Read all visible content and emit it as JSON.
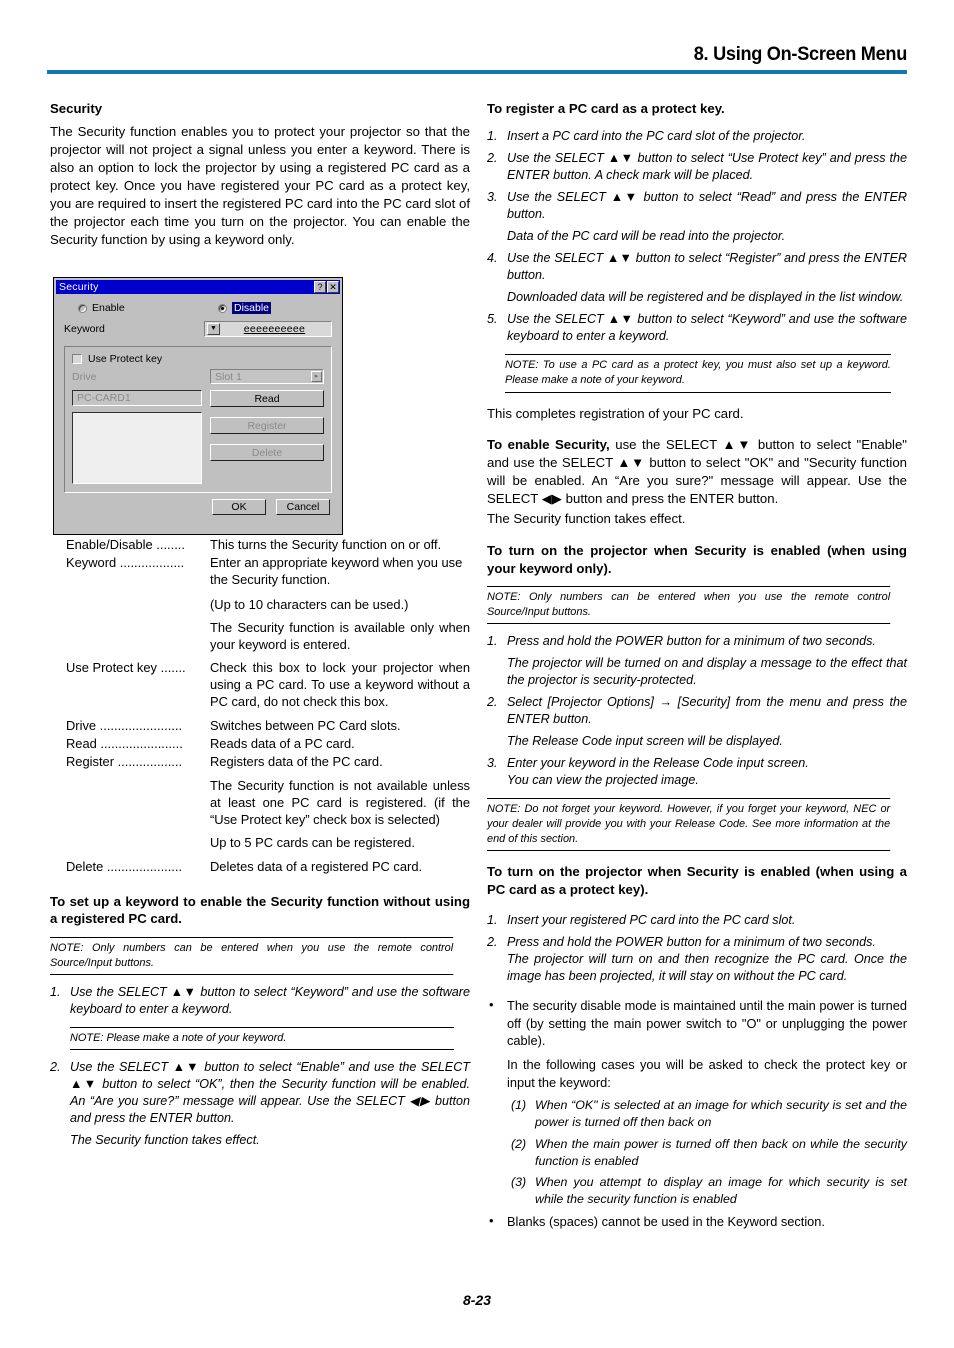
{
  "header": {
    "title": "8. Using On-Screen Menu",
    "rule_color": "#1478ae"
  },
  "left_column": {
    "section_title": "Security",
    "intro": "The Security function enables you to protect your projector so that the projector will not project a signal unless you enter a keyword. There is also an option to lock the projector by using a registered PC card as a protect key. Once you have registered your PC card as a protect key, you are required to insert the registered PC card into the PC card slot of the projector each time you turn on the projector. You can enable the Security function by using a keyword only.",
    "definitions": [
      {
        "term": "Enable/Disable ........",
        "desc": "This turns the Security function on or off.",
        "extra": []
      },
      {
        "term": "Keyword ..................",
        "desc": "Enter an appropriate keyword when you use the Security function.",
        "extra": [
          "(Up to 10 characters can be used.)",
          "The Security function is available only when your keyword is entered."
        ]
      },
      {
        "term": "Use Protect key .......",
        "desc": "Check this box to lock your projector when using a PC card. To use a keyword without a PC card, do not check this box.",
        "extra": []
      },
      {
        "term": "Drive .......................",
        "desc": "Switches between PC Card slots.",
        "extra": []
      },
      {
        "term": "Read .......................",
        "desc": "Reads data of a PC card.",
        "extra": []
      },
      {
        "term": "Register ..................",
        "desc": "Registers data of the PC card.",
        "extra": [
          "The Security function is not available unless at least one PC card is registered. (if the “Use Protect key” check box is selected)",
          "Up to 5 PC cards can be registered."
        ]
      },
      {
        "term": "Delete .....................",
        "desc": "Deletes data of a registered PC card.",
        "extra": []
      }
    ],
    "setup_heading": "To set up a keyword to enable the Security function without using a registered PC card.",
    "setup_note": "NOTE: Only numbers can be entered when you use the remote control Source/Input buttons.",
    "setup_steps": [
      {
        "num": "1.",
        "text": "Use the SELECT ▲▼ button to select “Keyword” and use the software keyboard to enter a keyword.",
        "note": "NOTE: Please make a note of your keyword."
      },
      {
        "num": "2.",
        "text": "Use the SELECT ▲▼ button to select “Enable” and use the SELECT ▲▼ button to select “OK”, then the Security function will be enabled. An “Are you sure?” message will appear. Use the SELECT ◀▶ button and press the ENTER button.",
        "note": "",
        "tail": "The Security function takes effect."
      }
    ]
  },
  "dialog": {
    "title": "Security",
    "help_button": "?",
    "close_button": "✕",
    "enable_label": "Enable",
    "disable_label": "Disable",
    "keyword_label": "Keyword",
    "keyword_value": "eeeeeeeeee",
    "dropdown_arrow": "▼",
    "use_protect_key_label": "Use Protect key",
    "drive_label": "Drive",
    "slot_value": "Slot 1",
    "slot_arrow": "▸",
    "pc_card_value": "PC-CARD1",
    "read_button": "Read",
    "register_button": "Register",
    "delete_button": "Delete",
    "ok_button": "OK",
    "cancel_button": "Cancel",
    "title_bar_color": "#0000cd",
    "face_color": "#c0c0c0",
    "selection_color": "#000080"
  },
  "right_column": {
    "register_heading": "To register a PC card as a protect key.",
    "register_steps": [
      {
        "num": "1.",
        "text": "Insert a PC card into the PC card slot of the projector."
      },
      {
        "num": "2.",
        "text": "Use the SELECT ▲▼ button to select “Use Protect key” and press the ENTER button. A check mark will be placed."
      },
      {
        "num": "3.",
        "text": "Use the SELECT ▲▼ button to select “Read” and press the ENTER button."
      },
      {
        "num": "",
        "text": "Data of the PC card will be read into the projector.",
        "plain": true
      },
      {
        "num": "4.",
        "text": "Use the SELECT ▲▼ button to select “Register” and press the ENTER button."
      },
      {
        "num": "",
        "text": "Downloaded data will be registered and be displayed in the list window.",
        "plain": true
      },
      {
        "num": "5.",
        "text": "Use the SELECT ▲▼ button to select “Keyword” and use the software keyboard to enter a keyword."
      }
    ],
    "register_note": "NOTE: To use a PC card as a protect key, you must also set up a keyword. Please make a note of your keyword.",
    "completes_text": "This completes registration of your PC card.",
    "enable_security_lead": "To enable Security,",
    "enable_security_body": " use the SELECT ▲▼ button to select \"Enable\" and use the SELECT ▲▼ button to select \"OK\" and \"Security function will be enabled. An “Are you sure?\" message will appear. Use the SELECT ◀▶ button and press the ENTER button.",
    "enable_security_tail": "The Security function takes effect.",
    "keyword_only_heading": "To turn on the projector when Security is enabled (when using your keyword only).",
    "keyword_only_note": "NOTE: Only numbers can be entered when you use the remote control Source/Input buttons.",
    "keyword_only_steps": [
      {
        "num": "1.",
        "text": "Press and hold the POWER button for a minimum of two seconds."
      },
      {
        "num": "",
        "text": "The projector will be turned on and display a message to the effect that the projector is security-protected.",
        "plain": true
      },
      {
        "num": "2.",
        "text": "Select [Projector Options] → [Security] from the menu and press the ENTER button."
      },
      {
        "num": "",
        "text": "The Release Code input screen will be displayed.",
        "plain": true
      },
      {
        "num": "3.",
        "text": "Enter your keyword in the Release Code input screen.",
        "tail": "You can view the projected image."
      }
    ],
    "keyword_only_note2": "NOTE: Do not forget your keyword. However, if you forget your keyword, NEC or your dealer will provide you with your Release Code. See more information at the end of this section.",
    "pc_card_heading": "To turn on the projector when Security is enabled (when using a PC card as a protect key).",
    "pc_card_steps": [
      {
        "num": "1.",
        "text": "Insert your registered PC card into the PC card slot."
      },
      {
        "num": "2.",
        "text": "Press and hold the POWER button for a minimum of two seconds.",
        "tail": "The projector will turn on and then recognize the PC card. Once the image has been projected, it will stay on without the PC card."
      }
    ],
    "bullets": [
      "The security disable mode is maintained until the main power is turned off (by setting the main power switch to \"O\" or unplugging the power cable).",
      "Blanks (spaces) cannot be used in the Keyword section."
    ],
    "following_cases_text": "In the following cases you will be asked to check the protect key or input the keyword:",
    "numbered_cases": [
      {
        "n": "(1)",
        "text": "When “OK\" is selected at an image for which security is set and the power is turned off then back on"
      },
      {
        "n": "(2)",
        "text": "When the main power is turned off then back on while the security function is enabled"
      },
      {
        "n": "(3)",
        "text": "When you attempt to display an image for which security is set while the security function is enabled"
      }
    ],
    "bullet_dot": "•"
  },
  "footer": {
    "page_number": "8-23"
  }
}
